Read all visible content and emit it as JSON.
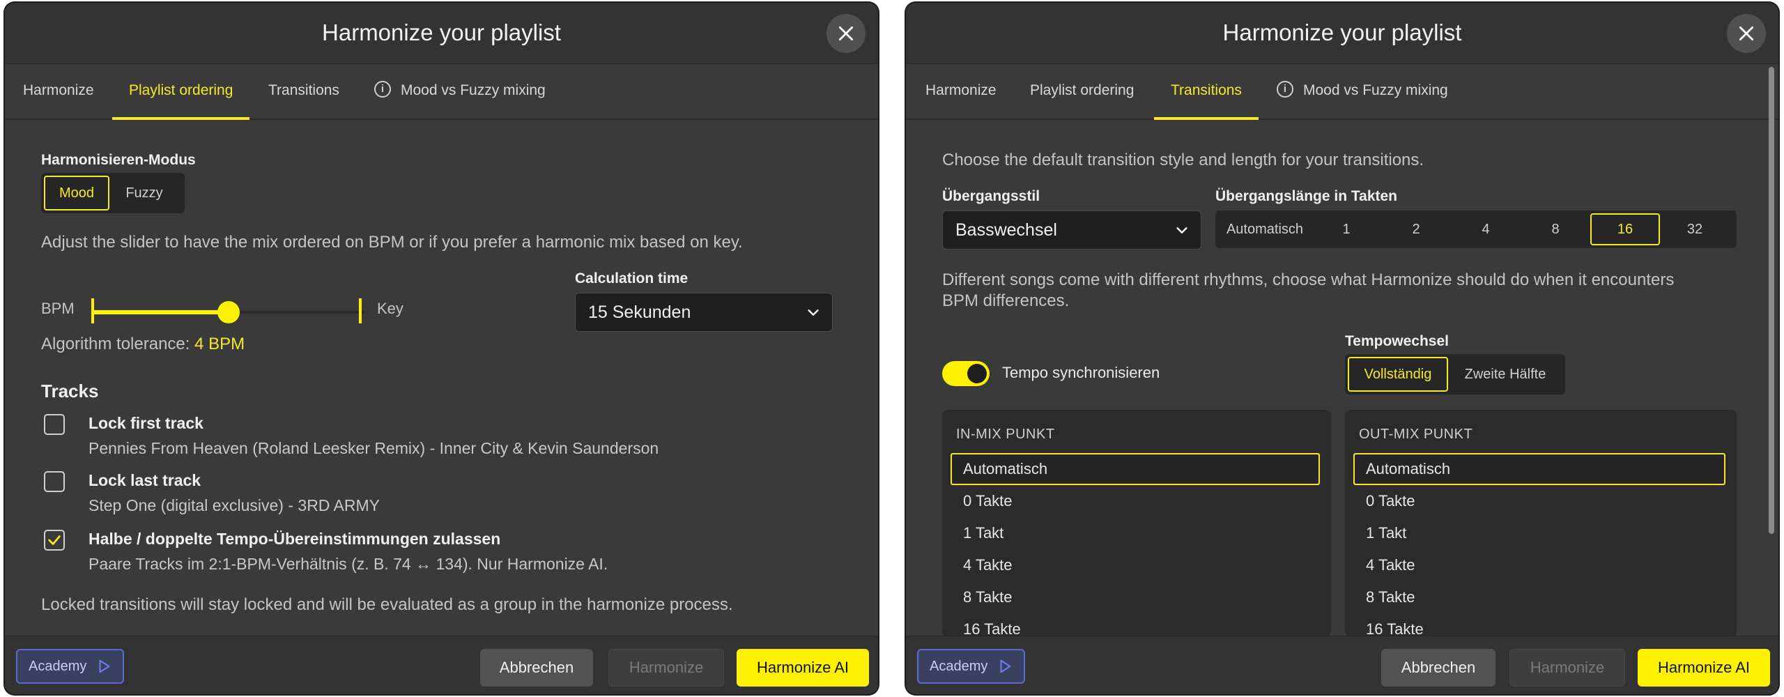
{
  "left": {
    "title": "Harmonize your playlist",
    "tabs": [
      "Harmonize",
      "Playlist ordering",
      "Transitions",
      "Mood vs Fuzzy mixing"
    ],
    "active_tab": "Playlist ordering",
    "mode_label": "Harmonisieren-Modus",
    "mode_options": [
      "Mood",
      "Fuzzy"
    ],
    "mode_selected": "Mood",
    "slider_desc": "Adjust the slider to have the mix ordered on BPM or if you prefer a harmonic mix based on key.",
    "slider_left": "BPM",
    "slider_right": "Key",
    "slider_value": 0.5,
    "tolerance_label": "Algorithm tolerance:",
    "tolerance_value": "4 BPM",
    "calc_label": "Calculation time",
    "calc_value": "15 Sekunden",
    "tracks_heading": "Tracks",
    "tracks": [
      {
        "title": "Lock first track",
        "sub": "Pennies From Heaven (Roland Leesker Remix) - Inner City & Kevin Saunderson",
        "checked": false
      },
      {
        "title": "Lock last track",
        "sub": "Step One (digital exclusive) - 3RD ARMY",
        "checked": false
      },
      {
        "title": "Halbe / doppelte Tempo-Übereinstimmungen zulassen",
        "sub": "Paare Tracks im 2:1-BPM-Verhältnis (z. B. 74 ↔ 134). Nur Harmonize AI.",
        "checked": true
      }
    ],
    "locked_note": "Locked transitions will stay locked and will be evaluated as a group in the harmonize process.",
    "footer": {
      "academy": "Academy",
      "cancel": "Abbrechen",
      "harmonize": "Harmonize",
      "harmonize_ai": "Harmonize AI"
    }
  },
  "right": {
    "title": "Harmonize your playlist",
    "tabs": [
      "Harmonize",
      "Playlist ordering",
      "Transitions",
      "Mood vs Fuzzy mixing"
    ],
    "active_tab": "Transitions",
    "intro": "Choose the default transition style and length for your transitions.",
    "style_label": "Übergangsstil",
    "style_value": "Basswechsel",
    "length_label": "Übergangslänge in Takten",
    "length_options": [
      "Automatisch",
      "1",
      "2",
      "4",
      "8",
      "16",
      "32"
    ],
    "length_selected": "16",
    "rhythm_desc_1": "Different songs come with different rhythms, choose what Harmonize should do when it encounters",
    "rhythm_desc_2": "BPM differences.",
    "tempo_sync_label": "Tempo synchronisieren",
    "tempo_sync_on": true,
    "tempo_change_label": "Tempowechsel",
    "tempo_change_options": [
      "Vollständig",
      "Zweite Hälfte"
    ],
    "tempo_change_selected": "Vollständig",
    "in_mix": {
      "title": "IN-MIX PUNKT",
      "items": [
        "Automatisch",
        "0 Takte",
        "1 Takt",
        "4 Takte",
        "8 Takte",
        "16 Takte"
      ],
      "selected": "Automatisch"
    },
    "out_mix": {
      "title": "OUT-MIX PUNKT",
      "items": [
        "Automatisch",
        "0 Takte",
        "1 Takt",
        "4 Takte",
        "8 Takte",
        "16 Takte"
      ],
      "selected": "Automatisch"
    },
    "footer": {
      "academy": "Academy",
      "cancel": "Abbrechen",
      "harmonize": "Harmonize",
      "harmonize_ai": "Harmonize AI"
    }
  },
  "colors": {
    "accent": "#fff200",
    "dialog_bg": "#3a3a3a",
    "academy_border": "#5a6ad8"
  },
  "icons": {
    "close": "close-icon",
    "chevron": "chevron-down-icon",
    "info": "info-icon",
    "play": "play-icon",
    "check": "check-icon"
  }
}
